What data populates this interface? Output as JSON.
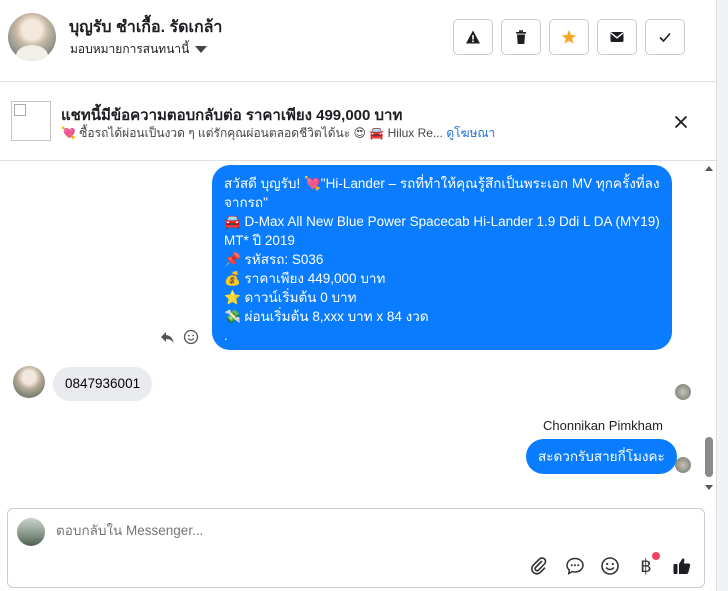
{
  "header": {
    "title": "บุญรับ ชำเกื้อ. รัดเกล้า",
    "assign_label": "มอบหมายการสนทนานี้",
    "buttons": [
      "report",
      "delete",
      "star",
      "mark-unread",
      "done"
    ]
  },
  "ad": {
    "title": "แชทนี้มีข้อความตอบกลับต่อ ราคาเพียง 499,000 บาท",
    "line": "💘 ซื้อรถได้ผ่อนเป็นงวด ๆ แต่รักคุณผ่อนตลอดชีวิตได้นะ 😍 🚘 Hilux Re...",
    "link": "ดูโฆษณา"
  },
  "messages": {
    "outgoing_1": [
      "สวัสดี บุญรับ! 💘\"Hi-Lander – รถที่ทำให้คุณรู้สึกเป็นพระเอก MV ทุกครั้งที่ลงจากรถ\"",
      "🚘  D-Max All New Blue Power Spacecab Hi-Lander 1.9 Ddi L DA (MY19) MT* ปี 2019",
      "📌 รหัสรถ: S036",
      "💰 ราคาเพียง 449,000 บาท",
      "⭐ ดาวน์เริ่มต้น 0 บาท",
      "💸 ผ่อนเริ่มต้น 8,xxx บาท x 84 งวด",
      "."
    ],
    "incoming_1": "0847936001",
    "sender_name": "Chonnikan Pimkham",
    "outgoing_2": "สะดวกรับสายกี่โมงคะ"
  },
  "composer": {
    "placeholder": "ตอบกลับใน Messenger..."
  },
  "colors": {
    "accent_blue": "#0a7cff",
    "incoming_bubble": "#e9ebee",
    "link": "#216fdb",
    "star": "#f5a623"
  }
}
